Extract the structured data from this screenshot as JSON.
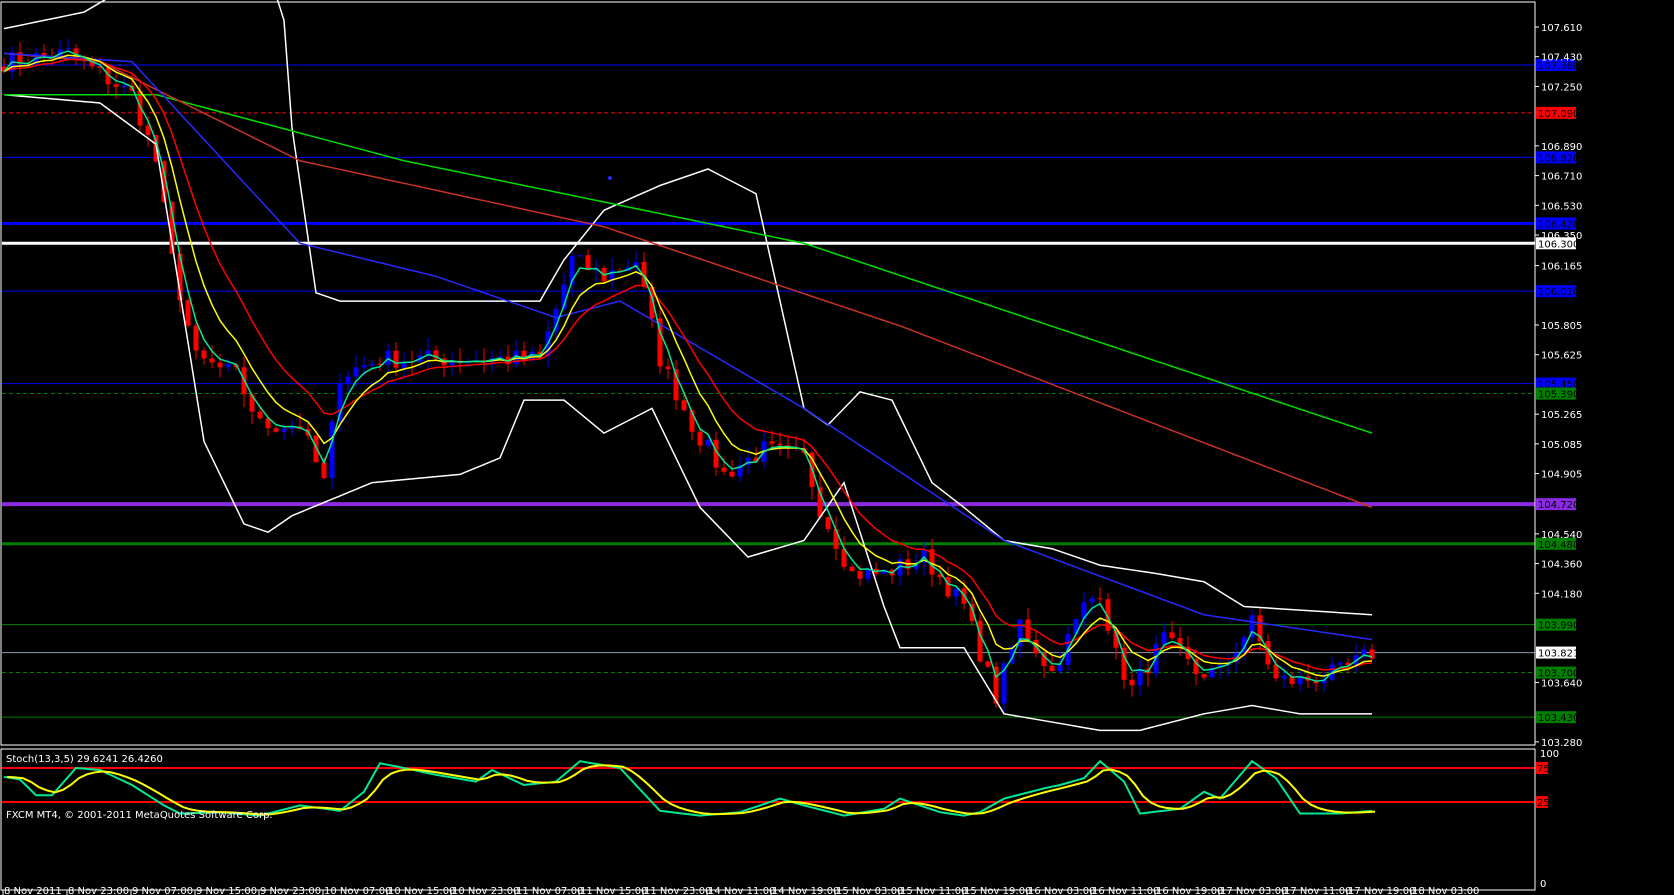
{
  "chart_data": {
    "type": "candlestick",
    "symbol_platform": "FXCM MT4, © 2001-2011 MetaQuotes Software Corp.",
    "price_axis": {
      "ylim": [
        103.28,
        107.61
      ],
      "ticks": [
        "107.610",
        "107.430",
        "107.250",
        "106.890",
        "106.710",
        "106.530",
        "106.350",
        "106.165",
        "105.805",
        "105.625",
        "105.265",
        "105.085",
        "104.905",
        "104.540",
        "104.360",
        "104.180",
        "103.640",
        "103.280"
      ]
    },
    "time_axis": {
      "ticks": [
        "8 Nov 2011",
        "8 Nov 23:00",
        "9 Nov 07:00",
        "9 Nov 15:00",
        "9 Nov 23:00",
        "10 Nov 07:00",
        "10 Nov 15:00",
        "10 Nov 23:00",
        "11 Nov 07:00",
        "11 Nov 15:00",
        "11 Nov 23:00",
        "14 Nov 11:00",
        "14 Nov 19:00",
        "15 Nov 03:00",
        "15 Nov 11:00",
        "15 Nov 19:00",
        "16 Nov 03:00",
        "16 Nov 11:00",
        "16 Nov 19:00",
        "17 Nov 03:00",
        "17 Nov 11:00",
        "17 Nov 19:00",
        "18 Nov 03:00"
      ]
    },
    "horizontal_lines": [
      {
        "label": "107.380",
        "price": 107.38,
        "color": "#0000ff",
        "style": "solid",
        "width": 1
      },
      {
        "label": "107.090",
        "price": 107.09,
        "color": "#ff0000",
        "style": "dashed",
        "width": 1
      },
      {
        "label": "106.820",
        "price": 106.82,
        "color": "#0000ff",
        "style": "solid",
        "width": 1
      },
      {
        "label": "106.420",
        "price": 106.42,
        "color": "#0000ff",
        "style": "solid",
        "width": 3
      },
      {
        "label": "106.300",
        "price": 106.3,
        "color": "#ffffff",
        "style": "solid",
        "width": 3
      },
      {
        "label": "106.010",
        "price": 106.01,
        "color": "#0000ff",
        "style": "solid",
        "width": 1
      },
      {
        "label": "105.450",
        "price": 105.45,
        "color": "#0000ff",
        "style": "solid",
        "width": 1
      },
      {
        "label": "105.390",
        "price": 105.39,
        "color": "#008000",
        "style": "dashed",
        "width": 1
      },
      {
        "label": "104.720",
        "price": 104.72,
        "color": "#8a2be2",
        "style": "solid",
        "width": 4
      },
      {
        "label": "104.480",
        "price": 104.48,
        "color": "#008000",
        "style": "solid",
        "width": 3
      },
      {
        "label": "103.990",
        "price": 103.99,
        "color": "#008000",
        "style": "solid",
        "width": 1
      },
      {
        "label": "103.821",
        "price": 103.821,
        "color": "#8a9aa8",
        "style": "solid",
        "width": 1
      },
      {
        "label": "103.700",
        "price": 103.7,
        "color": "#008000",
        "style": "dashed",
        "width": 1
      },
      {
        "label": "103.430",
        "price": 103.43,
        "color": "#008000",
        "style": "solid",
        "width": 1
      }
    ],
    "bars_total": 172,
    "close_keypoints_bar_price": [
      [
        0,
        107.4
      ],
      [
        8,
        107.45
      ],
      [
        16,
        107.2
      ],
      [
        19,
        106.8
      ],
      [
        21,
        106.2
      ],
      [
        24,
        105.6
      ],
      [
        29,
        105.5
      ],
      [
        32,
        105.2
      ],
      [
        37,
        105.2
      ],
      [
        40,
        104.85
      ],
      [
        42,
        105.5
      ],
      [
        47,
        105.6
      ],
      [
        52,
        105.6
      ],
      [
        60,
        105.6
      ],
      [
        67,
        105.6
      ],
      [
        71,
        106.2
      ],
      [
        75,
        106.1
      ],
      [
        79,
        106.2
      ],
      [
        82,
        105.6
      ],
      [
        86,
        105.2
      ],
      [
        90,
        104.9
      ],
      [
        95,
        105.05
      ],
      [
        100,
        105.0
      ],
      [
        102,
        104.7
      ],
      [
        106,
        104.3
      ],
      [
        110,
        104.3
      ],
      [
        115,
        104.4
      ],
      [
        120,
        104.1
      ],
      [
        124,
        103.55
      ],
      [
        127,
        104.0
      ],
      [
        131,
        103.7
      ],
      [
        135,
        104.1
      ],
      [
        137,
        104.2
      ],
      [
        139,
        103.8
      ],
      [
        141,
        103.6
      ],
      [
        145,
        103.9
      ],
      [
        149,
        103.7
      ],
      [
        152,
        103.7
      ],
      [
        156,
        104.0
      ],
      [
        159,
        103.65
      ],
      [
        162,
        103.65
      ],
      [
        167,
        103.7
      ],
      [
        171,
        103.82
      ]
    ],
    "ma_green": [
      [
        0,
        107.2
      ],
      [
        19,
        107.2
      ],
      [
        50,
        106.8
      ],
      [
        100,
        106.3
      ],
      [
        137,
        105.7
      ],
      [
        171,
        105.15
      ]
    ],
    "ma_red_slow": [
      [
        0,
        107.45
      ],
      [
        12,
        107.4
      ],
      [
        37,
        106.8
      ],
      [
        75,
        106.4
      ],
      [
        112,
        105.8
      ],
      [
        171,
        104.7
      ]
    ],
    "ma_blue": [
      [
        0,
        107.45
      ],
      [
        16,
        107.4
      ],
      [
        37,
        106.3
      ],
      [
        54,
        106.1
      ],
      [
        69,
        105.85
      ],
      [
        77,
        105.95
      ],
      [
        100,
        105.3
      ],
      [
        125,
        104.5
      ],
      [
        150,
        104.05
      ],
      [
        171,
        103.9
      ]
    ],
    "bollinger_upper": [
      [
        0,
        107.6
      ],
      [
        10,
        107.7
      ],
      [
        17,
        107.9
      ],
      [
        19,
        108.3
      ],
      [
        34,
        108.3
      ],
      [
        36,
        107.0
      ],
      [
        39,
        106.0
      ],
      [
        42,
        105.95
      ],
      [
        55,
        105.95
      ],
      [
        67,
        105.95
      ],
      [
        70,
        106.2
      ],
      [
        75,
        106.5
      ],
      [
        82,
        106.65
      ],
      [
        88,
        106.75
      ],
      [
        94,
        106.6
      ],
      [
        100,
        105.3
      ],
      [
        103,
        105.2
      ],
      [
        107,
        105.4
      ],
      [
        111,
        105.35
      ],
      [
        116,
        104.85
      ],
      [
        120,
        104.7
      ],
      [
        125,
        104.5
      ],
      [
        131,
        104.45
      ],
      [
        137,
        104.35
      ],
      [
        144,
        104.3
      ],
      [
        150,
        104.25
      ],
      [
        155,
        104.1
      ],
      [
        171,
        104.05
      ]
    ],
    "bollinger_lower": [
      [
        0,
        107.2
      ],
      [
        12,
        107.15
      ],
      [
        19,
        106.9
      ],
      [
        25,
        105.1
      ],
      [
        30,
        104.6
      ],
      [
        33,
        104.55
      ],
      [
        36,
        104.65
      ],
      [
        46,
        104.85
      ],
      [
        57,
        104.9
      ],
      [
        62,
        105.0
      ],
      [
        65,
        105.35
      ],
      [
        70,
        105.35
      ],
      [
        75,
        105.15
      ],
      [
        81,
        105.3
      ],
      [
        87,
        104.7
      ],
      [
        93,
        104.4
      ],
      [
        100,
        104.5
      ],
      [
        105,
        104.85
      ],
      [
        110,
        104.1
      ],
      [
        112,
        103.85
      ],
      [
        120,
        103.85
      ],
      [
        125,
        103.45
      ],
      [
        131,
        103.4
      ],
      [
        137,
        103.35
      ],
      [
        142,
        103.35
      ],
      [
        150,
        103.45
      ],
      [
        156,
        103.5
      ],
      [
        162,
        103.45
      ],
      [
        171,
        103.45
      ]
    ],
    "stochastic": {
      "label": "Stoch(13,3,5) 29.6241 26.4260",
      "levels": [
        "75",
        "25"
      ],
      "scale_labels": [
        "100",
        "0"
      ],
      "ylim": [
        0,
        100
      ],
      "main_keypoints_bar_value": [
        [
          0,
          62
        ],
        [
          2,
          58
        ],
        [
          4,
          35
        ],
        [
          6,
          35
        ],
        [
          9,
          75
        ],
        [
          12,
          72
        ],
        [
          16,
          50
        ],
        [
          20,
          20
        ],
        [
          22,
          8
        ],
        [
          27,
          10
        ],
        [
          32,
          5
        ],
        [
          37,
          20
        ],
        [
          42,
          12
        ],
        [
          45,
          40
        ],
        [
          47,
          82
        ],
        [
          50,
          75
        ],
        [
          54,
          65
        ],
        [
          59,
          55
        ],
        [
          61,
          72
        ],
        [
          65,
          50
        ],
        [
          69,
          55
        ],
        [
          72,
          85
        ],
        [
          77,
          75
        ],
        [
          82,
          12
        ],
        [
          87,
          5
        ],
        [
          92,
          10
        ],
        [
          97,
          30
        ],
        [
          100,
          20
        ],
        [
          105,
          5
        ],
        [
          110,
          15
        ],
        [
          112,
          30
        ],
        [
          117,
          10
        ],
        [
          120,
          5
        ],
        [
          122,
          10
        ],
        [
          125,
          30
        ],
        [
          130,
          45
        ],
        [
          132,
          50
        ],
        [
          135,
          60
        ],
        [
          137,
          85
        ],
        [
          140,
          55
        ],
        [
          142,
          8
        ],
        [
          147,
          15
        ],
        [
          150,
          40
        ],
        [
          152,
          30
        ],
        [
          156,
          85
        ],
        [
          159,
          60
        ],
        [
          162,
          8
        ],
        [
          167,
          8
        ],
        [
          171,
          12
        ]
      ]
    }
  }
}
